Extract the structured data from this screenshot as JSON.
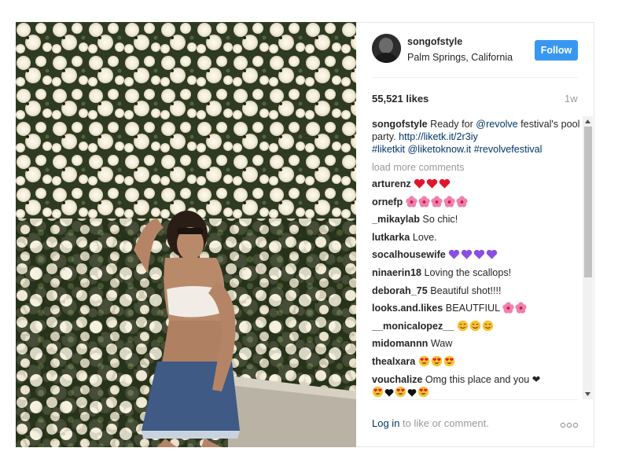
{
  "post": {
    "username": "songofstyle",
    "location": "Palm Springs, California",
    "follow_label": "Follow",
    "likes": "55,521 likes",
    "time_ago": "1w"
  },
  "caption": {
    "username": "songofstyle",
    "text_1": " Ready for ",
    "mention": "@revolve",
    "text_2": " festival's pool party. ",
    "url": "http://liketk.it/2r3iy",
    "hashtag_1": "#liketkit",
    "mention_2": "@liketoknow.it",
    "hashtag_2": "#revolvefestival"
  },
  "load_more": "load more comments",
  "comments": [
    {
      "user": "arturenz",
      "text": "",
      "emoji": "red-heart",
      "count": 3
    },
    {
      "user": "ornefp",
      "text": "",
      "emoji": "hibiscus",
      "count": 5
    },
    {
      "user": "_mikaylab",
      "text": "So chic!"
    },
    {
      "user": "lutkarka",
      "text": "Love."
    },
    {
      "user": "socalhousewife",
      "text": "",
      "emoji": "purple-heart",
      "count": 4
    },
    {
      "user": "ninaerin18",
      "text": "Loving the scallops!"
    },
    {
      "user": "deborah_75",
      "text": "Beautiful shot!!!!"
    },
    {
      "user": "looks.and.likes",
      "text": "BEAUTFIUL",
      "emoji": "hibiscus",
      "count": 2
    },
    {
      "user": "__monicalopez__",
      "text": "",
      "emoji": "smiling-face",
      "count": 3
    },
    {
      "user": "midomannn",
      "text": "Waw"
    },
    {
      "user": "thealxara",
      "text": "",
      "emoji": "heart-eyes",
      "count": 3
    },
    {
      "user": "vouchalize",
      "text": "Omg this place and you ❤",
      "emoji": "heart-eyes",
      "count": 2
    }
  ],
  "footer": {
    "login": "Log in",
    "rest": " to like or comment."
  },
  "colors": {
    "follow_button": "#3897f0",
    "link": "#003569",
    "muted_text": "#999999"
  },
  "icons": [
    "avatar",
    "scroll-up-arrow-icon",
    "scroll-down-arrow-icon",
    "more-options-icon"
  ]
}
